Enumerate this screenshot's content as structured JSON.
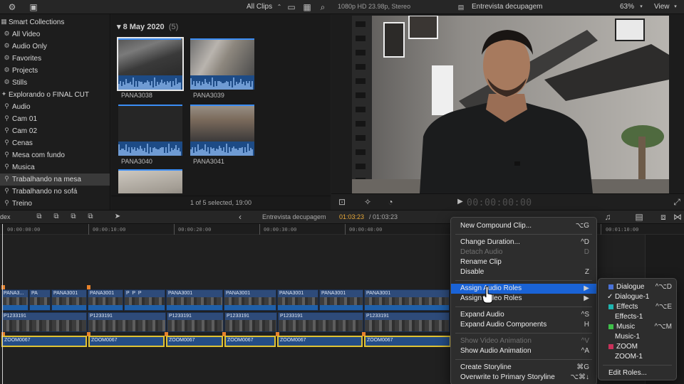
{
  "topbar": {
    "filter": "All Clips",
    "format": "1080p HD 23.98p, Stereo",
    "project": "Entrevista decupagem",
    "zoom": "63%",
    "view": "View"
  },
  "sidebar": {
    "items": [
      {
        "label": "Smart Collections",
        "icon": "smart-collection-folder-icon",
        "indent": 0
      },
      {
        "label": "All Video",
        "icon": "gear-icon",
        "indent": 1
      },
      {
        "label": "Audio Only",
        "icon": "gear-icon",
        "indent": 1
      },
      {
        "label": "Favorites",
        "icon": "gear-icon",
        "indent": 1
      },
      {
        "label": "Projects",
        "icon": "gear-icon",
        "indent": 1
      },
      {
        "label": "Stills",
        "icon": "gear-icon",
        "indent": 1
      },
      {
        "label": "Explorando o FINAL CUT",
        "icon": "event-star-icon",
        "indent": 0
      },
      {
        "label": "Audio",
        "icon": "keyword-icon",
        "indent": 1
      },
      {
        "label": "Cam 01",
        "icon": "keyword-icon",
        "indent": 1
      },
      {
        "label": "Cam 02",
        "icon": "keyword-icon",
        "indent": 1
      },
      {
        "label": "Cenas",
        "icon": "keyword-icon",
        "indent": 1
      },
      {
        "label": "Mesa com fundo",
        "icon": "keyword-icon",
        "indent": 1
      },
      {
        "label": "Musica",
        "icon": "keyword-icon",
        "indent": 1
      },
      {
        "label": "Trabalhando na mesa",
        "icon": "keyword-icon",
        "indent": 1,
        "selected": true
      },
      {
        "label": "Trabalhando no sofá",
        "icon": "keyword-icon",
        "indent": 1
      },
      {
        "label": "Treino",
        "icon": "keyword-icon",
        "indent": 1
      }
    ]
  },
  "browser": {
    "date": "8 May 2020",
    "count": "(5)",
    "clips": [
      {
        "name": "PANA3038",
        "selected": true
      },
      {
        "name": "PANA3039"
      },
      {
        "name": "PANA3040"
      },
      {
        "name": "PANA3041"
      },
      {
        "name": ""
      }
    ],
    "status": "1 of 5 selected, 19:00"
  },
  "viewer": {
    "timecode": "00:00:00:00"
  },
  "timeline": {
    "index_label": "dex",
    "project": "Entrevista decupagem",
    "current_time": "01:03:23",
    "duration": "/ 01:03:23",
    "ruler": [
      "00:00:00:00",
      "00:00:10:00",
      "00:00:20:00",
      "00:00:30:00",
      "00:00:40:00",
      "00:01:10:00"
    ],
    "video_clips": [
      "PANA3...",
      "PANA3001",
      "PANA3001",
      "PANA3001",
      "PANA3001",
      "PANA3001",
      "PANA3001",
      "PANA3001"
    ],
    "p_clips": [
      "P1233191",
      "P1233191",
      "P1233191",
      "P1233191",
      "P1233191",
      "P1233191",
      "P1233191"
    ],
    "audio_clips": [
      "ZOOM0067",
      "ZOOM0067",
      "ZOOM0067",
      "ZOOM0067",
      "ZOOM0067",
      "ZOOM0067"
    ]
  },
  "context_menu": {
    "items": [
      {
        "label": "New Compound Clip...",
        "shortcut": "⌥G"
      },
      {
        "sep": true
      },
      {
        "label": "Change Duration...",
        "shortcut": "^D"
      },
      {
        "label": "Detach Audio",
        "shortcut": "D",
        "disabled": true
      },
      {
        "label": "Rename Clip",
        "shortcut": ""
      },
      {
        "label": "Disable",
        "shortcut": "Z"
      },
      {
        "sep": true
      },
      {
        "label": "Assign Audio Roles",
        "shortcut": "▶",
        "highlighted": true
      },
      {
        "label": "Assign Video Roles",
        "shortcut": "▶"
      },
      {
        "sep": true
      },
      {
        "label": "Expand Audio",
        "shortcut": "^S"
      },
      {
        "label": "Expand Audio Components",
        "shortcut": "H"
      },
      {
        "sep": true
      },
      {
        "label": "Show Video Animation",
        "shortcut": "^V",
        "disabled": true
      },
      {
        "label": "Show Audio Animation",
        "shortcut": "^A"
      },
      {
        "sep": true
      },
      {
        "label": "Create Storyline",
        "shortcut": "⌘G"
      },
      {
        "label": "Overwrite to Primary Storyline",
        "shortcut": "⌥⌘↓"
      }
    ]
  },
  "audio_roles_submenu": {
    "items": [
      {
        "label": "Dialogue",
        "shortcut": "^⌥D",
        "color": "#4a72d8"
      },
      {
        "label": "Dialogue-1",
        "checked": true
      },
      {
        "label": "Effects",
        "shortcut": "^⌥E",
        "color": "#1fb5b0"
      },
      {
        "label": "Effects-1"
      },
      {
        "label": "Music",
        "shortcut": "^⌥M",
        "color": "#3fbf4a"
      },
      {
        "label": "Music-1"
      },
      {
        "label": "ZOOM",
        "color": "#c8325a"
      },
      {
        "label": "ZOOM-1"
      },
      {
        "sep": true
      },
      {
        "label": "Edit Roles..."
      }
    ]
  }
}
